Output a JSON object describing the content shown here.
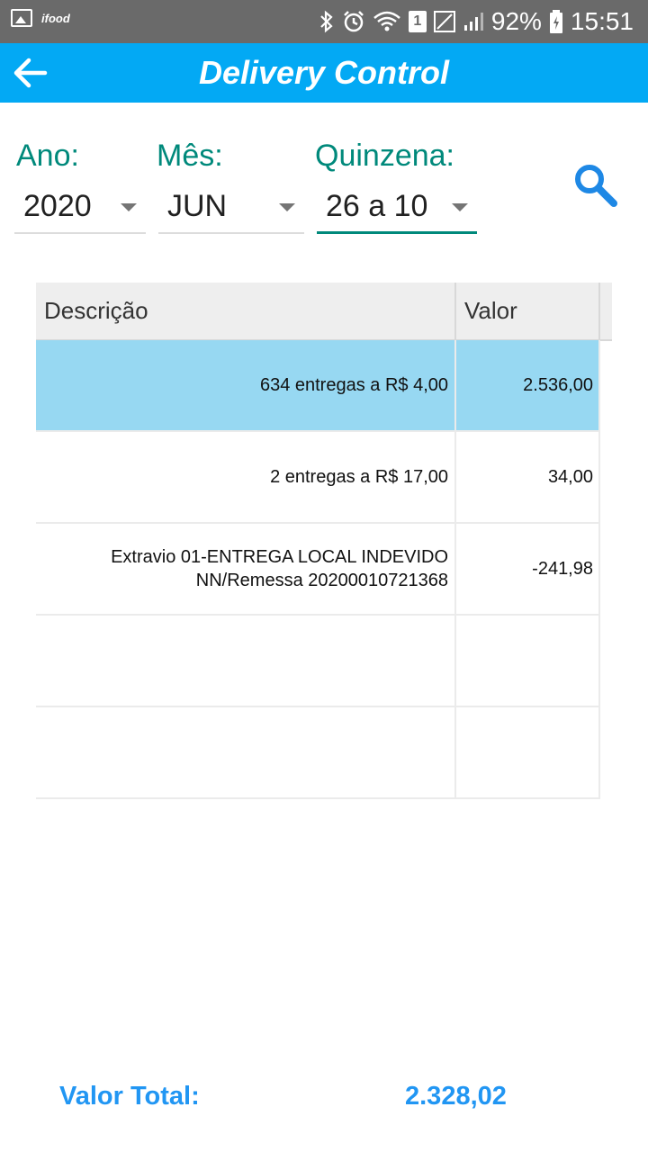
{
  "status_bar": {
    "notification_app": "ifood",
    "sim_slot": "1",
    "battery": "92%",
    "time": "15:51",
    "icons": [
      "image-icon",
      "ifood-icon",
      "bluetooth-icon",
      "alarm-icon",
      "wifi-icon",
      "sim-icon",
      "signal-icon",
      "battery-icon"
    ]
  },
  "app_bar": {
    "title": "Delivery Control",
    "back_icon": "arrow-left-icon",
    "color": "#03a9f4"
  },
  "filters": {
    "ano": {
      "label": "Ano:",
      "value": "2020"
    },
    "mes": {
      "label": "Mês:",
      "value": "JUN"
    },
    "quinzena": {
      "label": "Quinzena:",
      "value": "26 a 10"
    },
    "search_icon": "search-icon",
    "accent": "#00897b"
  },
  "table": {
    "headers": {
      "descricao": "Descrição",
      "valor": "Valor"
    },
    "rows": [
      {
        "descricao": "634 entregas a R$ 4,00",
        "valor": "2.536,00",
        "selected": true
      },
      {
        "descricao": "2 entregas a R$ 17,00",
        "valor": "34,00"
      },
      {
        "descricao": "Extravio 01-ENTREGA LOCAL INDEVIDO NN/Remessa 20200010721368",
        "valor": "-241,98"
      },
      {
        "descricao": "",
        "valor": ""
      },
      {
        "descricao": "",
        "valor": ""
      }
    ],
    "selected_color": "#97d8f2"
  },
  "total": {
    "label": "Valor Total:",
    "value": "2.328,02",
    "color": "#2196f3"
  }
}
